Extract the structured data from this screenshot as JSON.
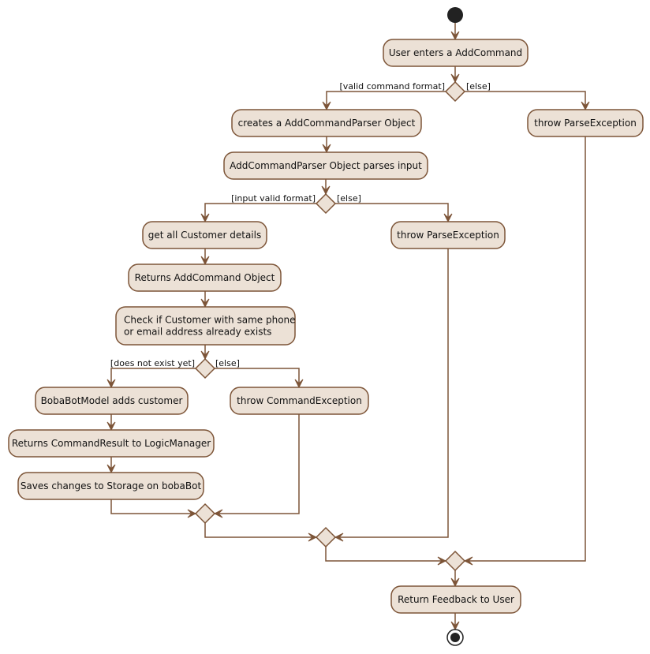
{
  "diagram": {
    "type": "uml-activity",
    "colors": {
      "activity_fill": "#ECE1D6",
      "border": "#7D5538",
      "text": "#111111",
      "start_node": "#222222"
    },
    "nodes": {
      "start": {
        "kind": "initial"
      },
      "user_enters": {
        "kind": "action",
        "label": [
          "User enters a AddCommand"
        ]
      },
      "dec1": {
        "kind": "decision"
      },
      "create_parser": {
        "kind": "action",
        "label": [
          "creates a AddCommandParser Object"
        ]
      },
      "throw_parse_1": {
        "kind": "action",
        "label": [
          "throw ParseException"
        ]
      },
      "parse_input": {
        "kind": "action",
        "label": [
          "AddCommandParser Object parses input"
        ]
      },
      "dec2": {
        "kind": "decision"
      },
      "get_details": {
        "kind": "action",
        "label": [
          "get all Customer details"
        ]
      },
      "throw_parse_2": {
        "kind": "action",
        "label": [
          "throw ParseException"
        ]
      },
      "returns_addcmd": {
        "kind": "action",
        "label": [
          "Returns AddCommand Object"
        ]
      },
      "check_exists": {
        "kind": "action",
        "label": [
          "Check if Customer with same phone",
          " or email address already exists"
        ]
      },
      "dec3": {
        "kind": "decision"
      },
      "model_adds": {
        "kind": "action",
        "label": [
          "BobaBotModel adds customer"
        ]
      },
      "throw_cmd": {
        "kind": "action",
        "label": [
          "throw CommandException"
        ]
      },
      "returns_result": {
        "kind": "action",
        "label": [
          "Returns CommandResult to LogicManager"
        ]
      },
      "saves_storage": {
        "kind": "action",
        "label": [
          "Saves changes to Storage on bobaBot"
        ]
      },
      "merge3": {
        "kind": "merge"
      },
      "merge2": {
        "kind": "merge"
      },
      "merge1": {
        "kind": "merge"
      },
      "return_feedback": {
        "kind": "action",
        "label": [
          "Return Feedback to User"
        ]
      },
      "end": {
        "kind": "final"
      }
    },
    "guards": {
      "dec1_yes": "[valid command format]",
      "dec1_no": "[else]",
      "dec2_yes": "[input valid format]",
      "dec2_no": "[else]",
      "dec3_yes": "[does not exist yet]",
      "dec3_no": "[else]"
    },
    "edges": [
      [
        "start",
        "user_enters"
      ],
      [
        "user_enters",
        "dec1"
      ],
      [
        "dec1",
        "create_parser",
        "dec1_yes"
      ],
      [
        "dec1",
        "throw_parse_1",
        "dec1_no"
      ],
      [
        "create_parser",
        "parse_input"
      ],
      [
        "parse_input",
        "dec2"
      ],
      [
        "dec2",
        "get_details",
        "dec2_yes"
      ],
      [
        "dec2",
        "throw_parse_2",
        "dec2_no"
      ],
      [
        "get_details",
        "returns_addcmd"
      ],
      [
        "returns_addcmd",
        "check_exists"
      ],
      [
        "check_exists",
        "dec3"
      ],
      [
        "dec3",
        "model_adds",
        "dec3_yes"
      ],
      [
        "dec3",
        "throw_cmd",
        "dec3_no"
      ],
      [
        "model_adds",
        "returns_result"
      ],
      [
        "returns_result",
        "saves_storage"
      ],
      [
        "saves_storage",
        "merge3"
      ],
      [
        "throw_cmd",
        "merge3"
      ],
      [
        "merge3",
        "merge2"
      ],
      [
        "throw_parse_2",
        "merge2"
      ],
      [
        "merge2",
        "merge1"
      ],
      [
        "throw_parse_1",
        "merge1"
      ],
      [
        "merge1",
        "return_feedback"
      ],
      [
        "return_feedback",
        "end"
      ]
    ]
  }
}
